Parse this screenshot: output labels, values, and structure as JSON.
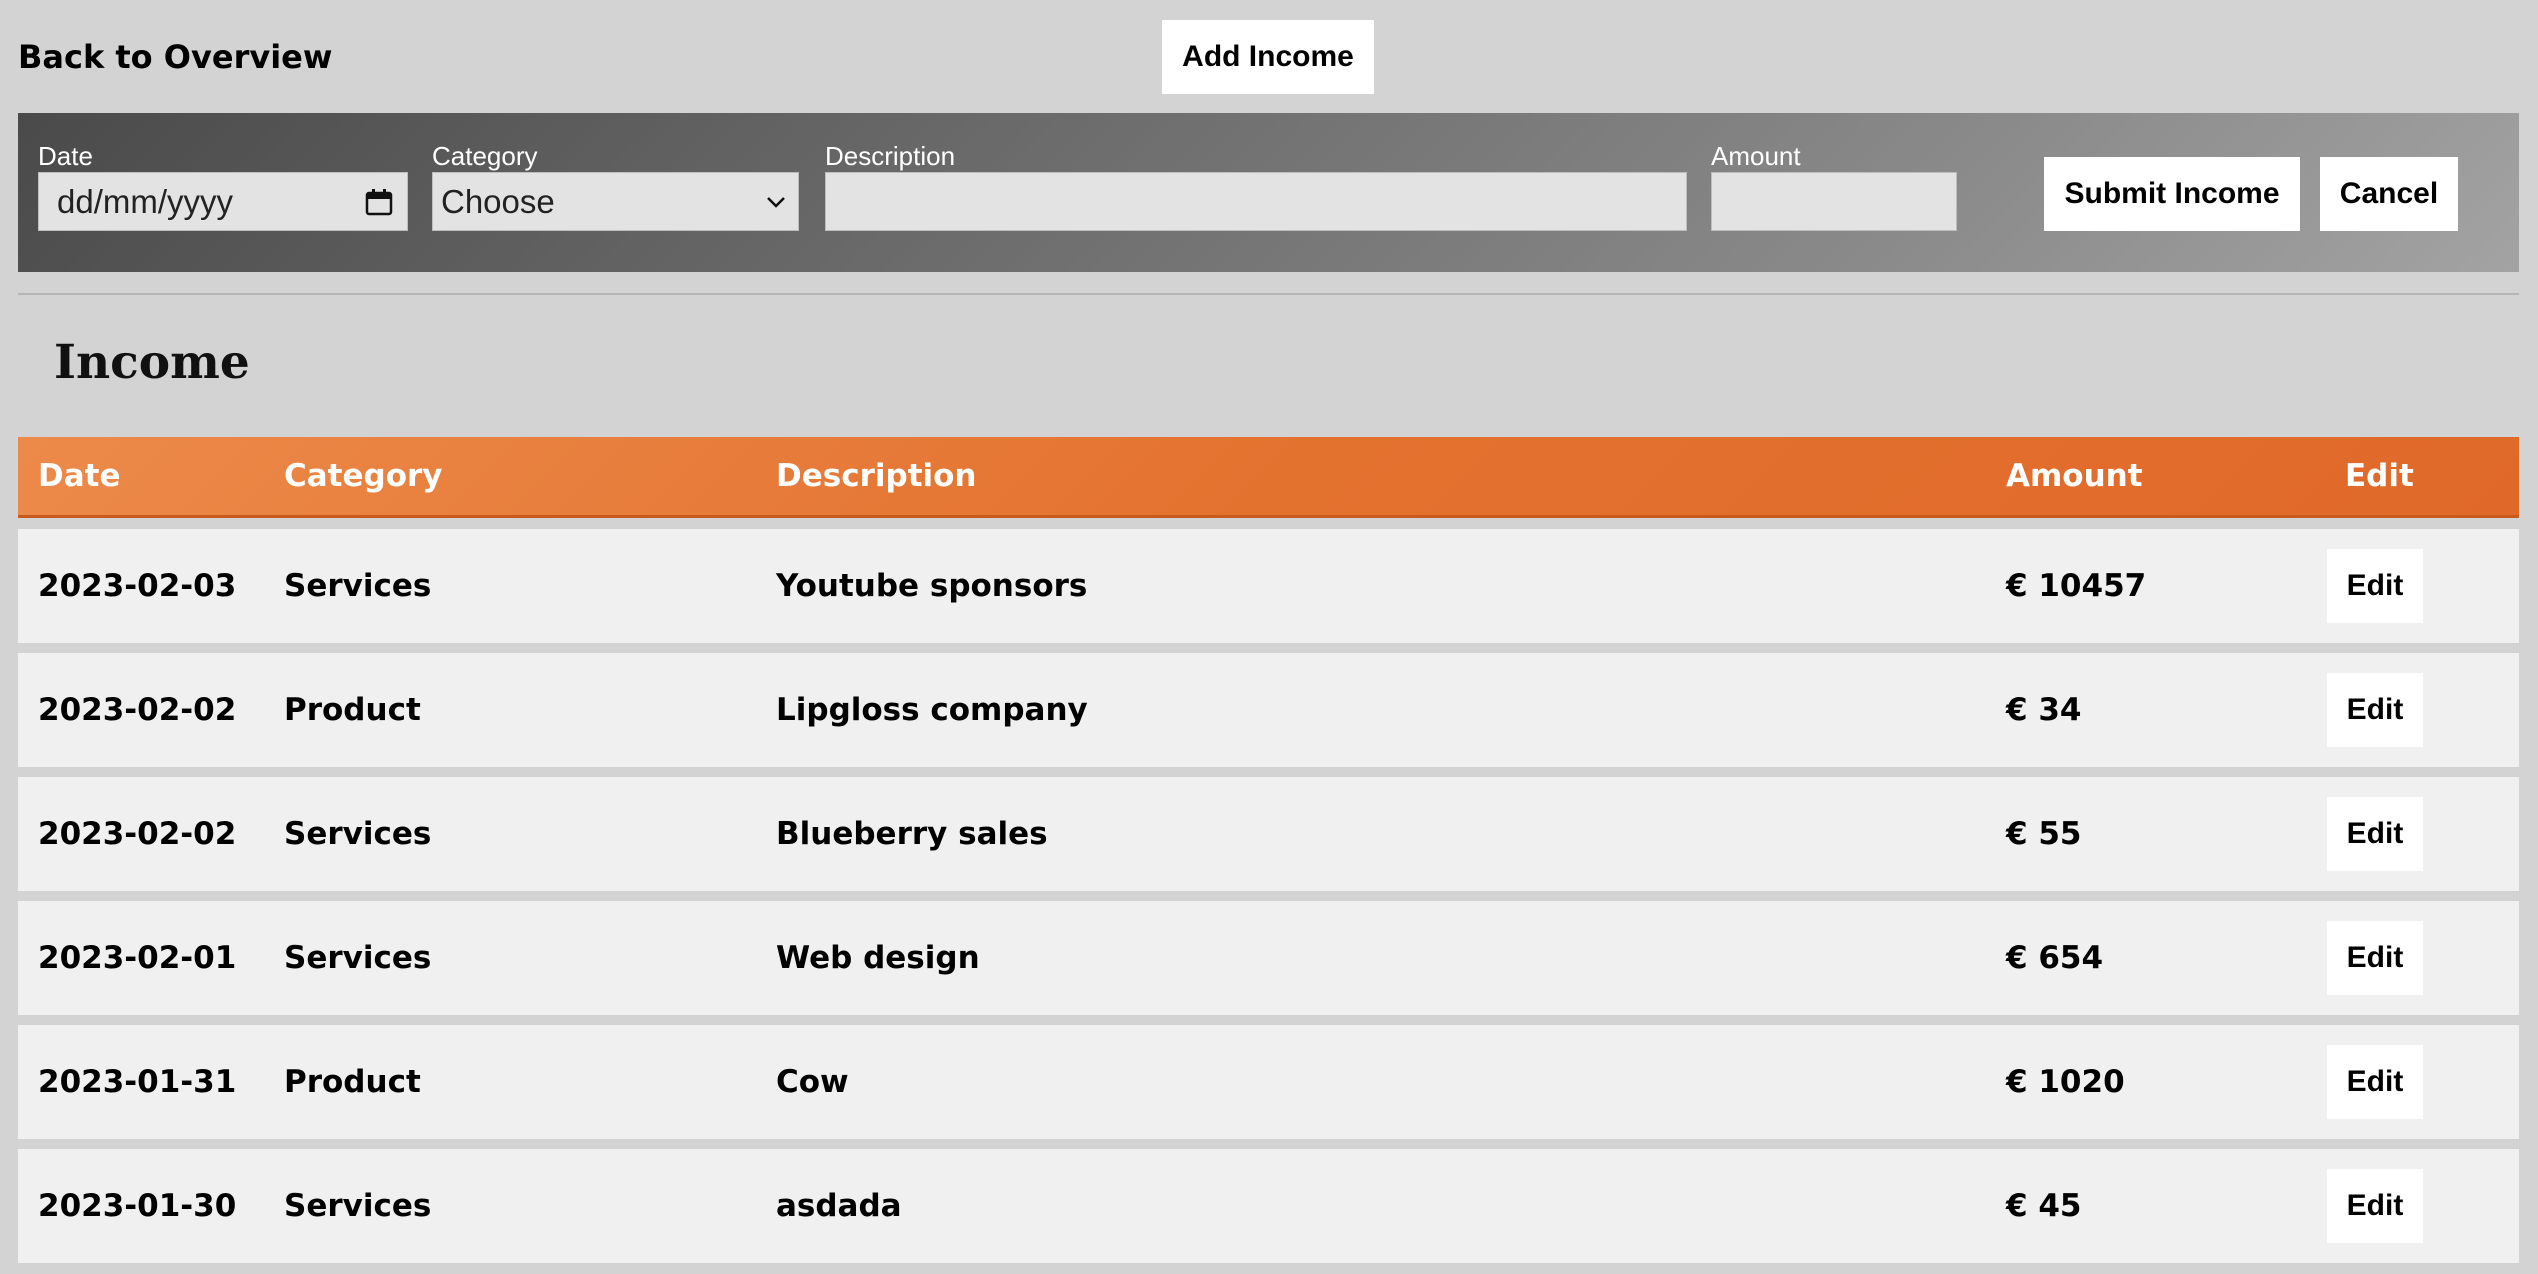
{
  "nav": {
    "back_label": "Back to Overview"
  },
  "toolbar": {
    "add_income_label": "Add Income"
  },
  "form": {
    "date_label": "Date",
    "date_placeholder": "dd/mm/yyyy",
    "category_label": "Category",
    "category_selected": "Choose",
    "description_label": "Description",
    "description_value": "",
    "amount_label": "Amount",
    "amount_value": "",
    "submit_label": "Submit Income",
    "cancel_label": "Cancel"
  },
  "page": {
    "title": "Income"
  },
  "table": {
    "headers": [
      "Date",
      "Category",
      "Description",
      "Amount",
      "Edit"
    ],
    "rows": [
      {
        "date": "2023-02-03",
        "category": "Services",
        "description": "Youtube sponsors",
        "amount": "€ 10457",
        "edit": "Edit"
      },
      {
        "date": "2023-02-02",
        "category": "Product",
        "description": "Lipgloss company",
        "amount": "€ 34",
        "edit": "Edit"
      },
      {
        "date": "2023-02-02",
        "category": "Services",
        "description": "Blueberry sales",
        "amount": "€ 55",
        "edit": "Edit"
      },
      {
        "date": "2023-02-01",
        "category": "Services",
        "description": "Web design",
        "amount": "€ 654",
        "edit": "Edit"
      },
      {
        "date": "2023-01-31",
        "category": "Product",
        "description": "Cow",
        "amount": "€ 1020",
        "edit": "Edit"
      },
      {
        "date": "2023-01-30",
        "category": "Services",
        "description": "asdada",
        "amount": "€ 45",
        "edit": "Edit"
      }
    ]
  },
  "colors": {
    "background": "#d3d3d3",
    "header_orange": "#e4722f",
    "row_background": "#f0f0f0"
  },
  "icons": {
    "date_picker": "calendar-icon",
    "select": "chevron-down-icon"
  }
}
